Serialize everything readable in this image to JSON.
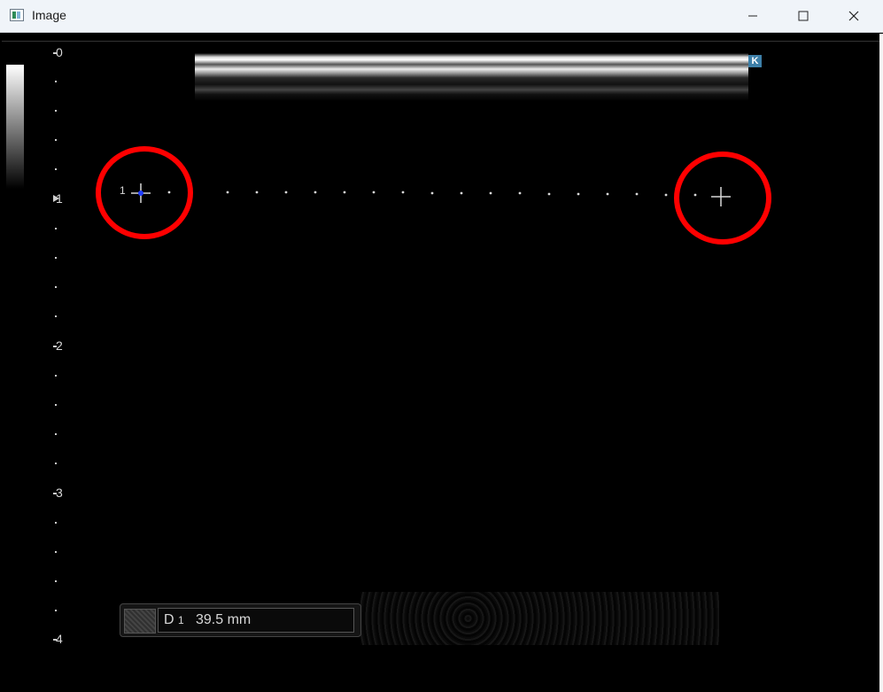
{
  "window": {
    "title": "Image"
  },
  "depth_scale": {
    "labels": [
      "0",
      "1",
      "2",
      "3",
      "4"
    ]
  },
  "probe_badge": "K",
  "calipers": {
    "start_label": "1"
  },
  "measurement": {
    "label": "D",
    "index": "1",
    "value": "39.5 mm"
  },
  "colors": {
    "background": "#000000",
    "annotation": "#ff0000",
    "caliper": "#d8d8d8",
    "active_caliper": "#1f3cff"
  },
  "icons": {
    "minimize": "minimize-icon",
    "maximize": "maximize-icon",
    "close": "close-icon",
    "cursor": "crosshair-icon"
  }
}
